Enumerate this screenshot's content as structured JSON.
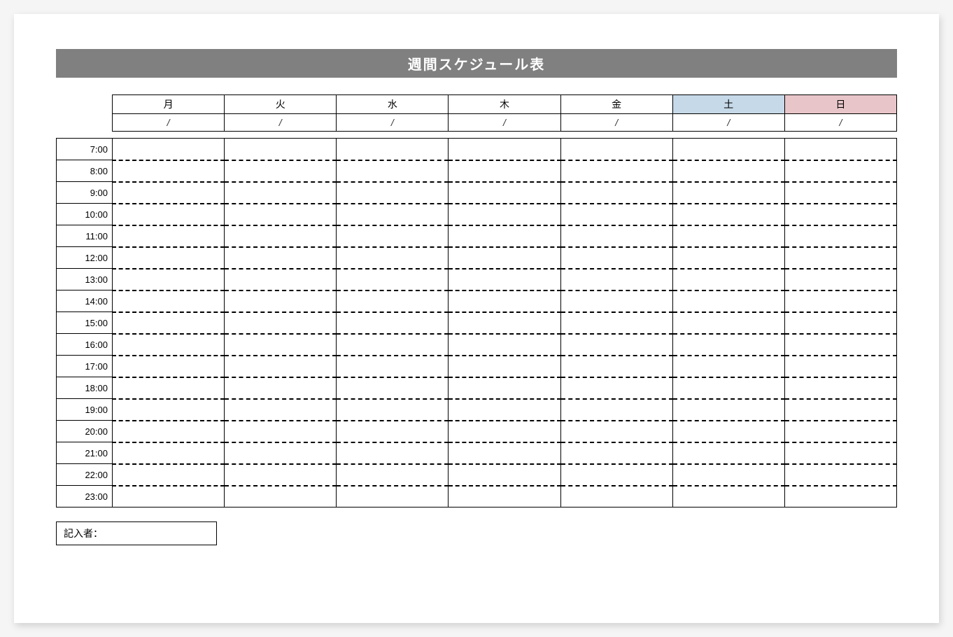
{
  "title": "週間スケジュール表",
  "days": [
    "月",
    "火",
    "水",
    "木",
    "金",
    "土",
    "日"
  ],
  "date_placeholder": "/",
  "times": [
    "7:00",
    "8:00",
    "9:00",
    "10:00",
    "11:00",
    "12:00",
    "13:00",
    "14:00",
    "15:00",
    "16:00",
    "17:00",
    "18:00",
    "19:00",
    "20:00",
    "21:00",
    "22:00",
    "23:00"
  ],
  "author_label": "記入者：",
  "colors": {
    "title_bg": "#808080",
    "sat_bg": "#c5d9e8",
    "sun_bg": "#e8c5c8"
  }
}
